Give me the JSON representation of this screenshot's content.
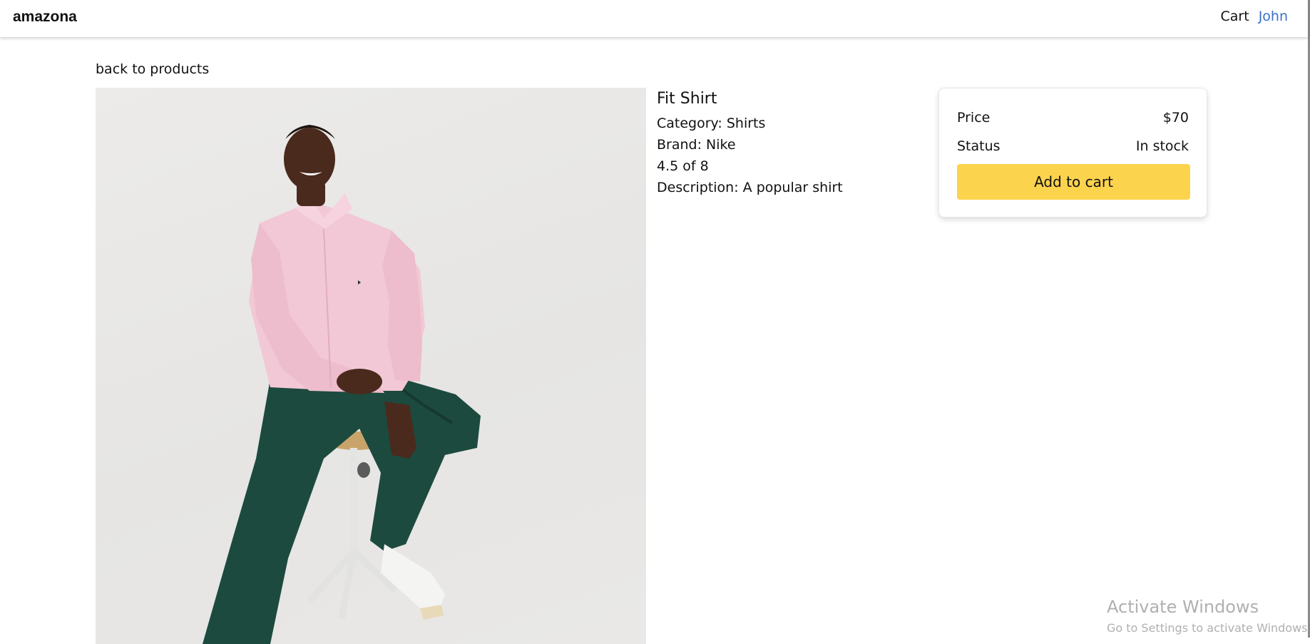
{
  "navbar": {
    "brand": "amazona",
    "cart_label": "Cart",
    "user_label": "John"
  },
  "back_link": "back to products",
  "product": {
    "image_icon": "product-photo",
    "name": "Fit Shirt",
    "category": "Category: Shirts",
    "brand": "Brand: Nike",
    "rating": "4.5 of 8",
    "description": "Description: A popular shirt"
  },
  "buy_card": {
    "price_label": "Price",
    "price_value": "$70",
    "status_label": "Status",
    "status_value": "In stock",
    "add_button": "Add to cart"
  },
  "watermark": {
    "title": "Activate Windows",
    "subtitle": "Go to Settings to activate Windows."
  },
  "colors": {
    "accent": "#3b6fc9",
    "button": "#fcd34d",
    "shirt": "#f2c8d6",
    "pants": "#1c4a3f"
  }
}
